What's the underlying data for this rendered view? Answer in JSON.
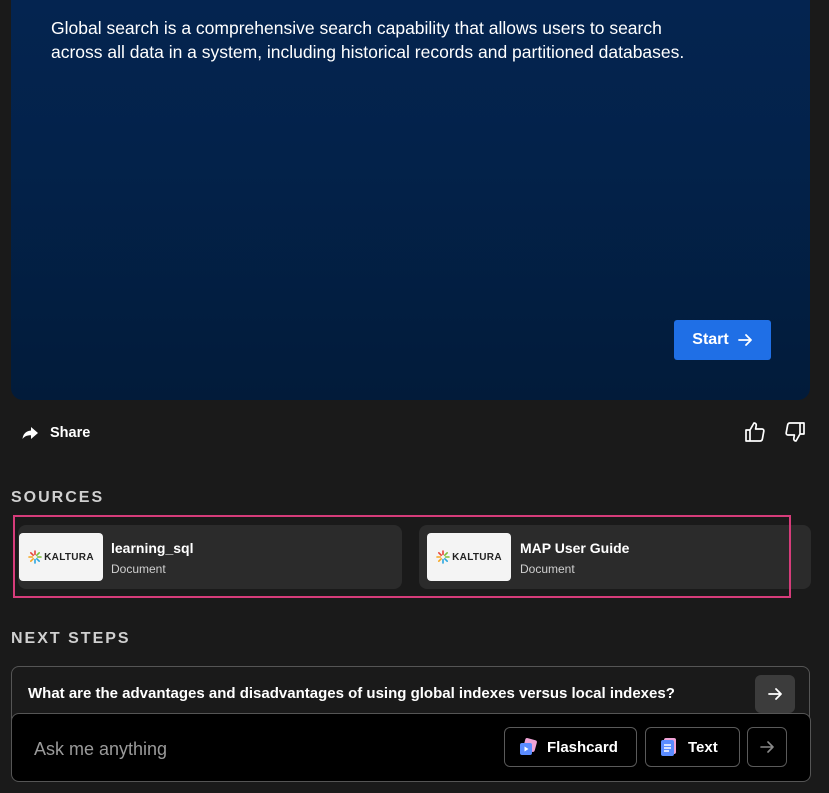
{
  "hero": {
    "description": "Global search is a comprehensive search capability that allows users to search across all data in a system, including historical records and partitioned databases.",
    "start_label": "Start"
  },
  "actions": {
    "share_label": "Share"
  },
  "sources": {
    "heading": "SOURCES",
    "items": [
      {
        "logo_text": "KALTURA",
        "title": "learning_sql",
        "type": "Document"
      },
      {
        "logo_text": "KALTURA",
        "title": "MAP User Guide",
        "type": "Document"
      }
    ]
  },
  "next_steps": {
    "heading": "NEXT STEPS",
    "items": [
      {
        "question": "What are the advantages and disadvantages of using global indexes versus local indexes?"
      }
    ]
  },
  "ask": {
    "placeholder": "Ask me anything",
    "flashcard_label": "Flashcard",
    "text_label": "Text"
  },
  "colors": {
    "accent": "#1f6fe6",
    "highlight_border": "#d63c7a",
    "hero_bg": "#03224a"
  }
}
